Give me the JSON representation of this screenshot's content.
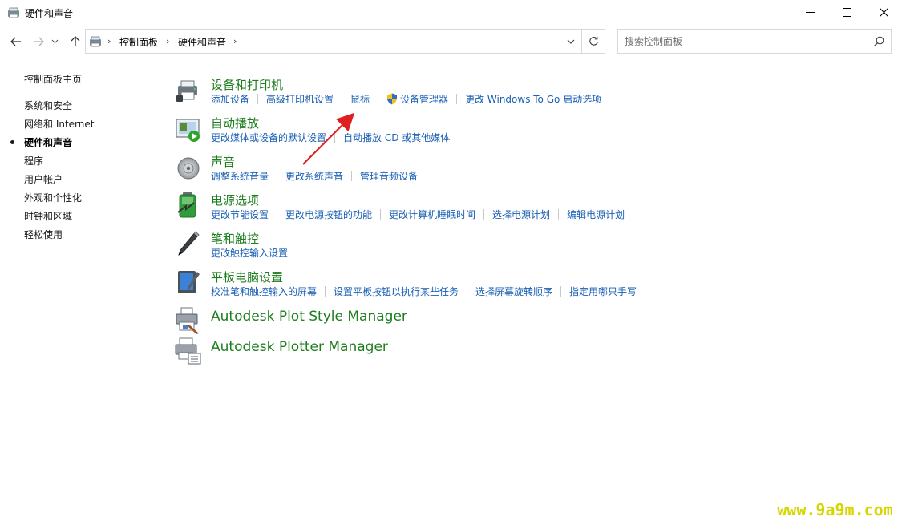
{
  "window": {
    "title": "硬件和声音",
    "icon": "control-panel-icon"
  },
  "address": {
    "crumbs": [
      "控制面板",
      "硬件和声音"
    ]
  },
  "search": {
    "placeholder": "搜索控制面板"
  },
  "sidebar": {
    "items": [
      {
        "label": "控制面板主页",
        "active": false
      },
      {
        "label": "系统和安全",
        "active": false
      },
      {
        "label": "网络和 Internet",
        "active": false
      },
      {
        "label": "硬件和声音",
        "active": true
      },
      {
        "label": "程序",
        "active": false
      },
      {
        "label": "用户帐户",
        "active": false
      },
      {
        "label": "外观和个性化",
        "active": false
      },
      {
        "label": "时钟和区域",
        "active": false
      },
      {
        "label": "轻松使用",
        "active": false
      }
    ]
  },
  "categories": [
    {
      "title": "设备和打印机",
      "icon": "devices-printers-icon",
      "links": [
        "添加设备",
        "高级打印机设置",
        "鼠标",
        "设备管理器",
        "更改 Windows To Go 启动选项"
      ]
    },
    {
      "title": "自动播放",
      "icon": "autoplay-icon",
      "links": [
        "更改媒体或设备的默认设置",
        "自动播放 CD 或其他媒体"
      ]
    },
    {
      "title": "声音",
      "icon": "speaker-icon",
      "links": [
        "调整系统音量",
        "更改系统声音",
        "管理音频设备"
      ]
    },
    {
      "title": "电源选项",
      "icon": "battery-icon",
      "links": [
        "更改节能设置",
        "更改电源按钮的功能",
        "更改计算机睡眠时间",
        "选择电源计划",
        "编辑电源计划"
      ]
    },
    {
      "title": "笔和触控",
      "icon": "pen-icon",
      "links": [
        "更改触控输入设置"
      ]
    },
    {
      "title": "平板电脑设置",
      "icon": "tablet-icon",
      "links": [
        "校准笔和触控输入的屏幕",
        "设置平板按钮以执行某些任务",
        "选择屏幕旋转顺序",
        "指定用哪只手写"
      ]
    },
    {
      "title": "Autodesk Plot Style Manager",
      "icon": "plot-style-printer-icon",
      "links": []
    },
    {
      "title": "Autodesk Plotter Manager",
      "icon": "plotter-icon",
      "links": []
    }
  ],
  "watermark": {
    "text": "www.9a9m.com"
  },
  "colors": {
    "category_title": "#1e7d1e",
    "link": "#1a5fb4",
    "annotation_arrow": "#e02020",
    "watermark": "#d6d600"
  }
}
